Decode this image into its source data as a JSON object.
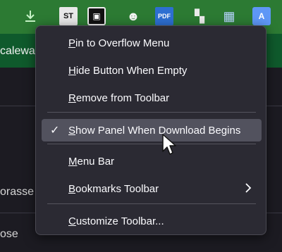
{
  "toolbar": {
    "icons": [
      "download-icon",
      "st-extension-icon",
      "note-extension-icon",
      "mask-extension-icon",
      "pdf-extension-icon",
      "grid-add-icon",
      "tiles-icon",
      "translate-icon"
    ],
    "st_text": "ST",
    "pdf_text": "PDF"
  },
  "bookmarks": {
    "partial_text": "caleway"
  },
  "page": {
    "text_1": "orasse",
    "text_2": "ose"
  },
  "menu": {
    "items": [
      {
        "accel": "P",
        "rest": "in to Overflow Menu"
      },
      {
        "accel": "H",
        "rest": "ide Button When Empty"
      },
      {
        "accel": "R",
        "rest": "emove from Toolbar"
      },
      {
        "accel": "S",
        "rest": "how Panel When Download Begins",
        "checked": true,
        "hovered": true
      },
      {
        "accel": "M",
        "rest": "enu Bar"
      },
      {
        "accel": "B",
        "rest": "ookmarks Toolbar",
        "submenu": true
      },
      {
        "accel": "C",
        "rest": "ustomize Toolbar..."
      }
    ]
  },
  "colors": {
    "toolbar_bg": "#2c7a33",
    "bookmarks_bg": "#0f5a2c",
    "menu_bg": "#2b2a33",
    "hover_bg": "#52525e",
    "page_bg": "#1c1b22"
  }
}
